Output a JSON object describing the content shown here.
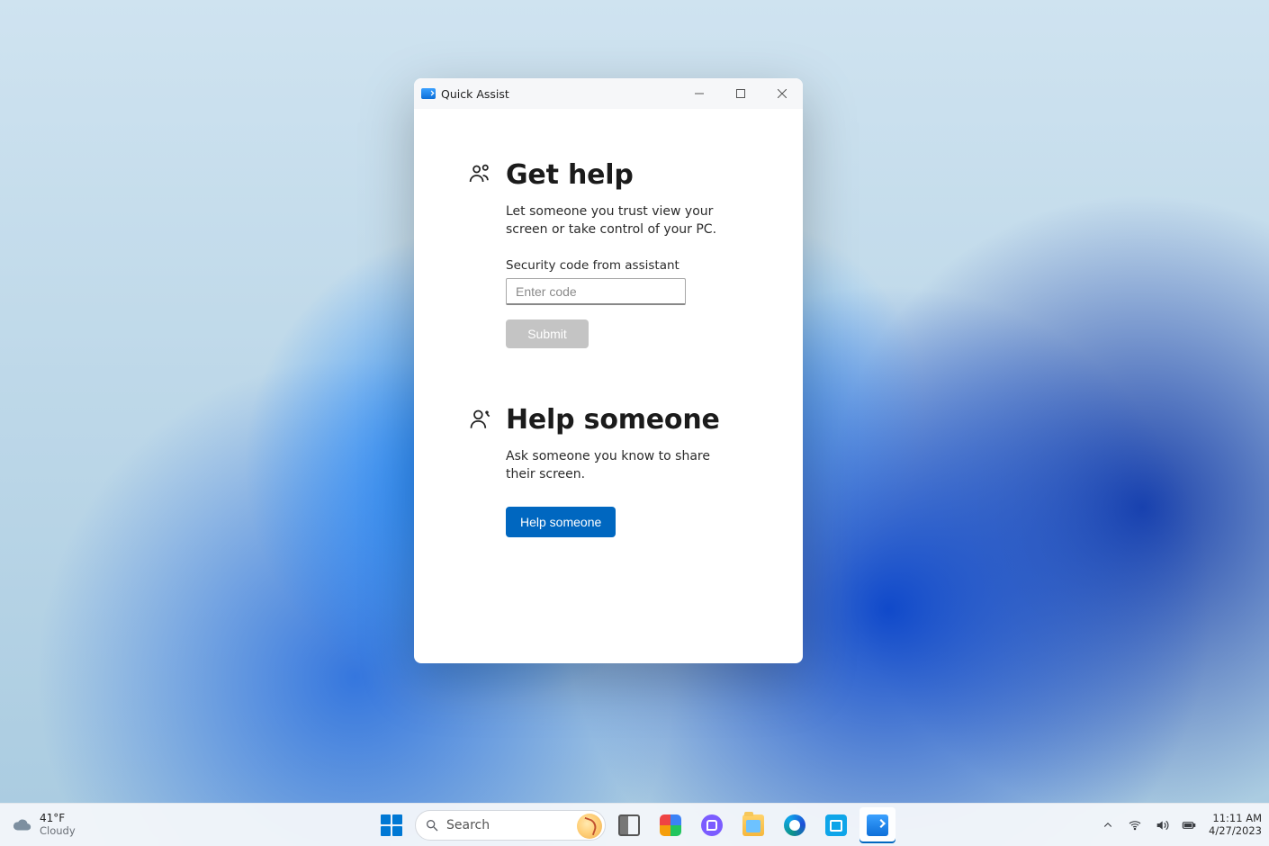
{
  "window": {
    "title": "Quick Assist",
    "get_help": {
      "heading": "Get help",
      "desc": "Let someone you trust view your screen or take control of your PC.",
      "code_label": "Security code from assistant",
      "code_placeholder": "Enter code",
      "submit_label": "Submit"
    },
    "help_someone": {
      "heading": "Help someone",
      "desc": "Ask someone you know to share their screen.",
      "button_label": "Help someone"
    }
  },
  "taskbar": {
    "weather": {
      "temp": "41°F",
      "cond": "Cloudy"
    },
    "search_placeholder": "Search",
    "clock": {
      "time": "11:11 AM",
      "date": "4/27/2023"
    }
  },
  "colors": {
    "accent": "#0067c0"
  }
}
